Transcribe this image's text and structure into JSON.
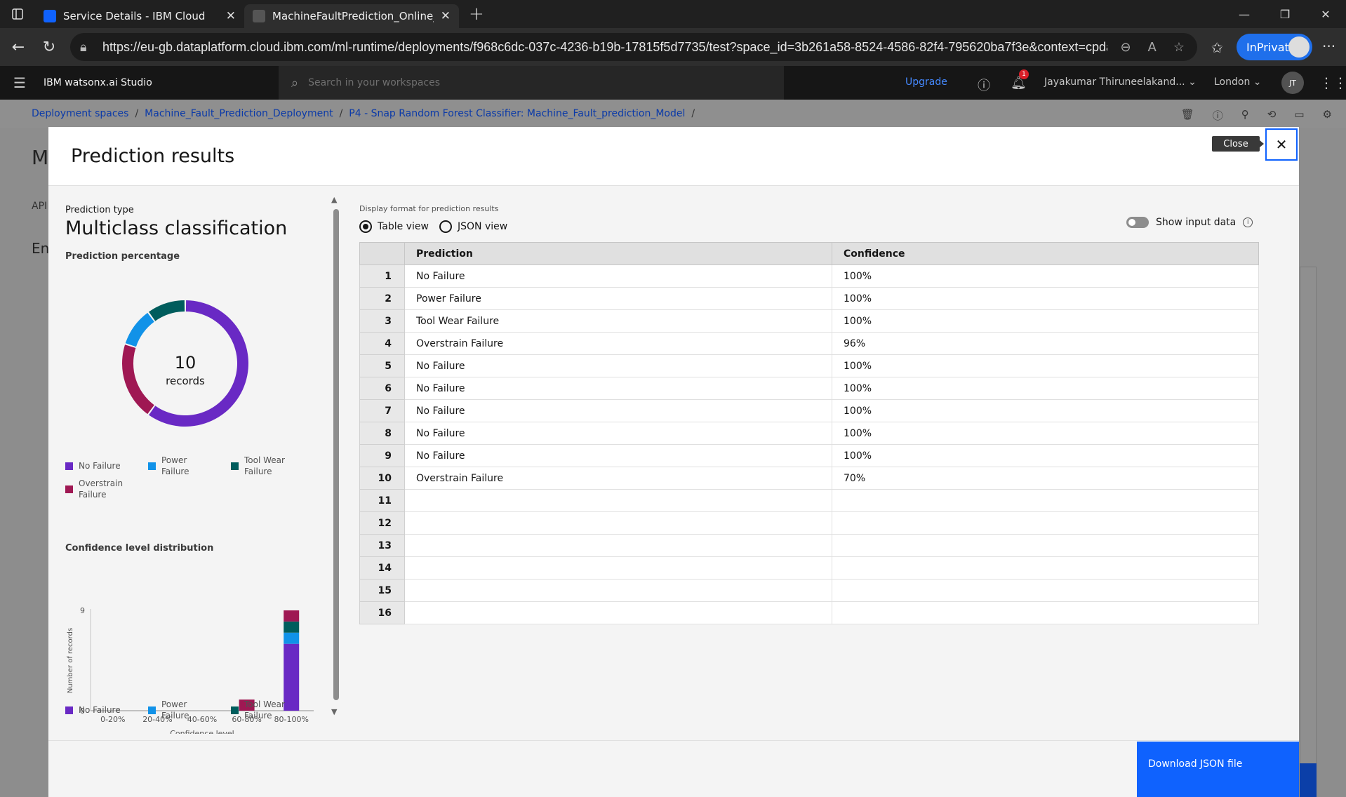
{
  "browser": {
    "tabs": [
      {
        "title": "Service Details - IBM Cloud",
        "active": false
      },
      {
        "title": "MachineFaultPrediction_Online_D",
        "active": true
      }
    ],
    "url": "https://eu-gb.dataplatform.cloud.ibm.com/ml-runtime/deployments/f968c6dc-037c-4236-b19b-17815f5d7735/test?space_id=3b261a58-8524-4586-82f4-795620ba7f3e&context=cpda...",
    "inprivate_label": "InPrivate"
  },
  "header": {
    "product": "IBM watsonx.ai Studio",
    "search_placeholder": "Search in your workspaces",
    "upgrade": "Upgrade",
    "notification_count": "1",
    "account": "Jayakumar Thiruneelakand...",
    "region": "London",
    "avatar_initials": "JT"
  },
  "breadcrumb": {
    "items": [
      "Deployment spaces",
      "Machine_Fault_Prediction_Deployment",
      "P4 - Snap Random Forest Classifier: Machine_Fault_prediction_Model"
    ],
    "separator": "/"
  },
  "background": {
    "title_initial": "M",
    "tab_initial": "API",
    "section_initial": "En"
  },
  "modal": {
    "title": "Prediction results",
    "close_tooltip": "Close",
    "prediction_type_label": "Prediction type",
    "prediction_type": "Multiclass classification",
    "prediction_percentage_title": "Prediction percentage",
    "donut_total": "10",
    "donut_unit": "records",
    "confidence_title": "Confidence level distribution",
    "display_format_label": "Display format for prediction results",
    "table_view": "Table view",
    "json_view": "JSON view",
    "show_input": "Show input data",
    "download_button": "Download JSON file",
    "legend": [
      {
        "name": "No Failure",
        "color": "#6929c4"
      },
      {
        "name": "Power Failure",
        "color": "#1192e8"
      },
      {
        "name": "Tool Wear Failure",
        "color": "#005d5d"
      },
      {
        "name": "Overstrain Failure",
        "color": "#9f1853"
      }
    ],
    "table": {
      "headers": [
        "Prediction",
        "Confidence"
      ],
      "rows": [
        {
          "n": "1",
          "prediction": "No Failure",
          "confidence": "100%"
        },
        {
          "n": "2",
          "prediction": "Power Failure",
          "confidence": "100%"
        },
        {
          "n": "3",
          "prediction": "Tool Wear Failure",
          "confidence": "100%"
        },
        {
          "n": "4",
          "prediction": "Overstrain Failure",
          "confidence": "96%"
        },
        {
          "n": "5",
          "prediction": "No Failure",
          "confidence": "100%"
        },
        {
          "n": "6",
          "prediction": "No Failure",
          "confidence": "100%"
        },
        {
          "n": "7",
          "prediction": "No Failure",
          "confidence": "100%"
        },
        {
          "n": "8",
          "prediction": "No Failure",
          "confidence": "100%"
        },
        {
          "n": "9",
          "prediction": "No Failure",
          "confidence": "100%"
        },
        {
          "n": "10",
          "prediction": "Overstrain Failure",
          "confidence": "70%"
        },
        {
          "n": "11",
          "prediction": "",
          "confidence": ""
        },
        {
          "n": "12",
          "prediction": "",
          "confidence": ""
        },
        {
          "n": "13",
          "prediction": "",
          "confidence": ""
        },
        {
          "n": "14",
          "prediction": "",
          "confidence": ""
        },
        {
          "n": "15",
          "prediction": "",
          "confidence": ""
        },
        {
          "n": "16",
          "prediction": "",
          "confidence": ""
        }
      ]
    }
  },
  "chart_data": [
    {
      "type": "pie",
      "title": "Prediction percentage",
      "categories": [
        "No Failure",
        "Overstrain Failure",
        "Power Failure",
        "Tool Wear Failure"
      ],
      "values": [
        6,
        2,
        1,
        1
      ],
      "colors": [
        "#6929c4",
        "#9f1853",
        "#1192e8",
        "#005d5d"
      ]
    },
    {
      "type": "bar",
      "title": "Confidence level distribution",
      "xlabel": "Confidence level",
      "ylabel": "Number of records",
      "categories": [
        "0-20%",
        "20-40%",
        "40-60%",
        "60-80%",
        "80-100%"
      ],
      "ylim": [
        0,
        9
      ],
      "yticks": [
        "0",
        "9"
      ],
      "series": [
        {
          "name": "No Failure",
          "color": "#6929c4",
          "values": [
            0,
            0,
            0,
            0,
            6
          ]
        },
        {
          "name": "Power Failure",
          "color": "#1192e8",
          "values": [
            0,
            0,
            0,
            0,
            1
          ]
        },
        {
          "name": "Tool Wear Failure",
          "color": "#005d5d",
          "values": [
            0,
            0,
            0,
            0,
            1
          ]
        },
        {
          "name": "Overstrain Failure",
          "color": "#9f1853",
          "values": [
            0,
            0,
            0,
            1,
            1
          ]
        }
      ]
    }
  ]
}
